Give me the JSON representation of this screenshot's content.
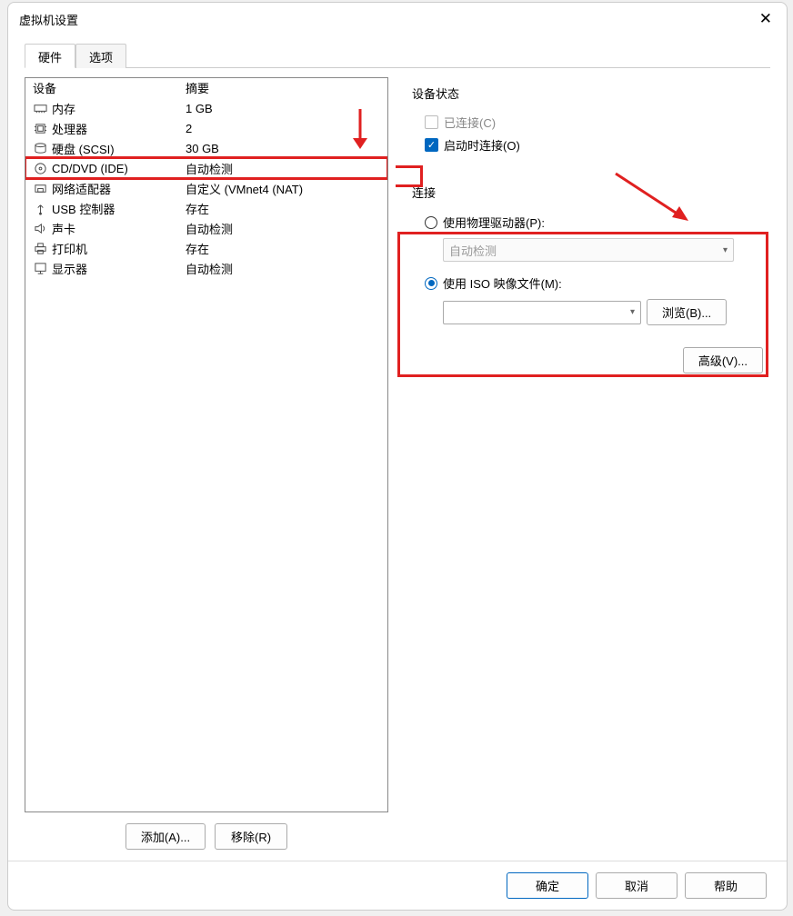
{
  "window": {
    "title": "虚拟机设置"
  },
  "tabs": {
    "hardwareLabel": "硬件",
    "optionsLabel": "选项"
  },
  "hwtable": {
    "header": {
      "device": "设备",
      "summary": "摘要"
    },
    "rows": [
      {
        "icon": "memory",
        "name": "内存",
        "summary": "1 GB"
      },
      {
        "icon": "cpu",
        "name": "处理器",
        "summary": "2"
      },
      {
        "icon": "disk",
        "name": "硬盘 (SCSI)",
        "summary": "30 GB"
      },
      {
        "icon": "cd",
        "name": "CD/DVD (IDE)",
        "summary": "自动检测"
      },
      {
        "icon": "nic",
        "name": "网络适配器",
        "summary": "自定义 (VMnet4 (NAT)"
      },
      {
        "icon": "usb",
        "name": "USB 控制器",
        "summary": "存在"
      },
      {
        "icon": "sound",
        "name": "声卡",
        "summary": "自动检测"
      },
      {
        "icon": "printer",
        "name": "打印机",
        "summary": "存在"
      },
      {
        "icon": "display",
        "name": "显示器",
        "summary": "自动检测"
      }
    ]
  },
  "belowButtons": {
    "add": "添加(A)...",
    "remove": "移除(R)"
  },
  "right": {
    "deviceStatusLabel": "设备状态",
    "connectedLabel": "已连接(C)",
    "connectAtPowerOnLabel": "启动时连接(O)",
    "connectionLabel": "连接",
    "usePhysicalLabel": "使用物理驱动器(P):",
    "physicalDropdownValue": "自动检测",
    "useIsoLabel": "使用 ISO 映像文件(M):",
    "isoPathValue": "",
    "browseLabel": "浏览(B)...",
    "advancedLabel": "高级(V)..."
  },
  "footer": {
    "ok": "确定",
    "cancel": "取消",
    "help": "帮助"
  }
}
